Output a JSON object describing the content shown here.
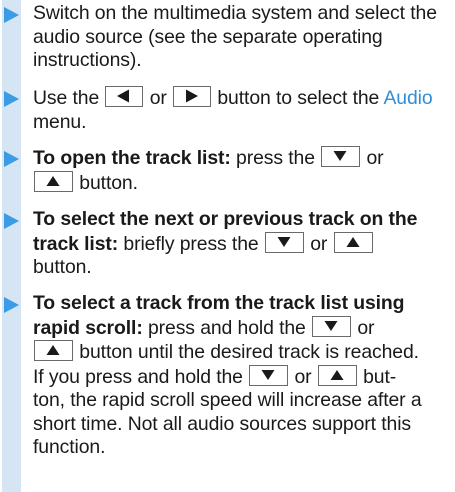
{
  "steps": [
    {
      "text": "Switch on the multimedia system and select the audio source (see the separate operating instructions)."
    },
    {
      "pre": "Use the",
      "mid": "or",
      "post": "button to select the",
      "link": "Audio",
      "end": "menu.",
      "buttons": [
        "left-arrow",
        "right-arrow"
      ]
    },
    {
      "bold": "To open the track list:",
      "pre": "press the",
      "mid": "or",
      "post": "button.",
      "buttons": [
        "down-arrow",
        "up-arrow"
      ]
    },
    {
      "bold": "To select the next or previous track on the track list:",
      "pre": "briefly press the",
      "mid": "or",
      "post": "button.",
      "buttons": [
        "down-arrow",
        "up-arrow"
      ]
    },
    {
      "bold": "To select a track from the track list using rapid scroll:",
      "pre": "press and hold the",
      "mid": "or",
      "post": "button until the desired track is reached.",
      "buttons": [
        "down-arrow",
        "up-arrow"
      ],
      "note": {
        "pre": "If you press and hold the",
        "mid": "or",
        "post_a": "but-",
        "post_b": "ton, the rapid scroll speed will increase after a short time. Not all audio sources support this function.",
        "buttons": [
          "down-arrow",
          "up-arrow"
        ]
      }
    }
  ],
  "colors": {
    "accent": "#3b9be4",
    "link": "#2f8fd9",
    "bar": "#d5e5f3",
    "text": "#1a1a1a"
  }
}
